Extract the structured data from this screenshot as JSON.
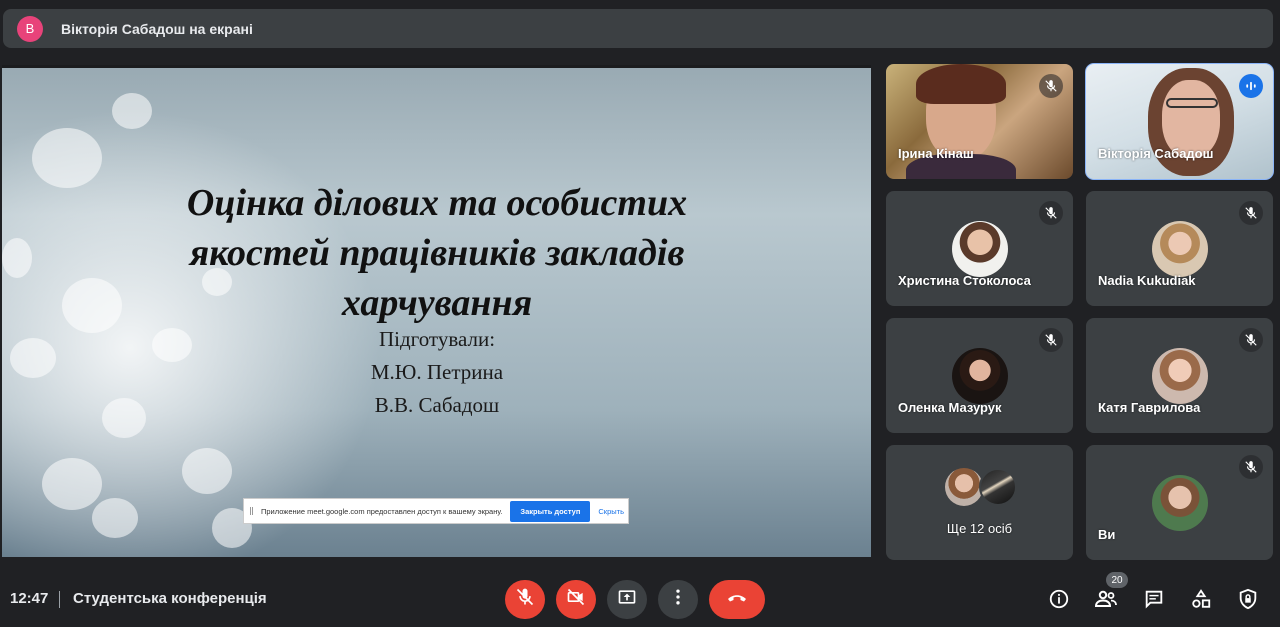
{
  "banner": {
    "avatar_letter": "В",
    "title": "Вікторія Сабадош на екрані"
  },
  "slide": {
    "title_lines": [
      "Оцінка ділових та особистих",
      "якостей працівників закладів",
      "харчування"
    ],
    "prepared_by": "Підготували:",
    "authors": [
      "М.Ю. Петрина",
      "В.В. Сабадош"
    ]
  },
  "share_bar": {
    "message": "Приложение meet.google.com предоставлен доступ к вашему экрану.",
    "stop_label": "Закрыть доступ",
    "hide_label": "Скрыть"
  },
  "participants": [
    {
      "name": "Ірина Кінаш",
      "muted": true
    },
    {
      "name": "Вікторія Сабадош",
      "speaking": true
    },
    {
      "name": "Христина Стоколоса",
      "muted": true
    },
    {
      "name": "Nadia Kukudiak",
      "muted": true
    },
    {
      "name": "Оленка Мазурук",
      "muted": true
    },
    {
      "name": "Катя Гаврилова",
      "muted": true
    },
    {
      "name": "Ще 12 осіб"
    },
    {
      "name": "Ви",
      "muted": true
    }
  ],
  "bottom": {
    "time": "12:47",
    "meeting_name": "Студентська конференція",
    "people_count": "20"
  },
  "colors": {
    "end_call": "#ea4335",
    "accent": "#1a73e8",
    "tile_bg": "#3c4043",
    "page_bg": "#202124"
  }
}
